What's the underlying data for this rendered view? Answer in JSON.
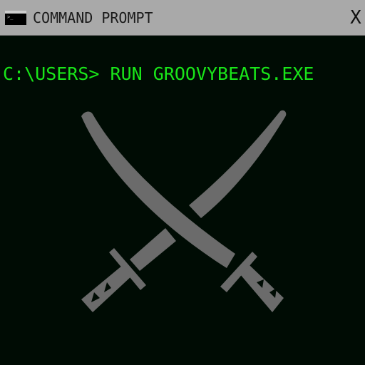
{
  "window": {
    "title": "COMMAND PROMPT",
    "close_label": "X",
    "icon": "terminal-icon",
    "icon_prompt": ">_"
  },
  "console": {
    "command": "C:\\USERS> RUN GROOVYBEATS.EXE",
    "text_color": "#19e619",
    "background_color": "#000c04"
  },
  "artwork": {
    "icon": "crossed-swords-icon",
    "color": "#6b6b6b"
  }
}
